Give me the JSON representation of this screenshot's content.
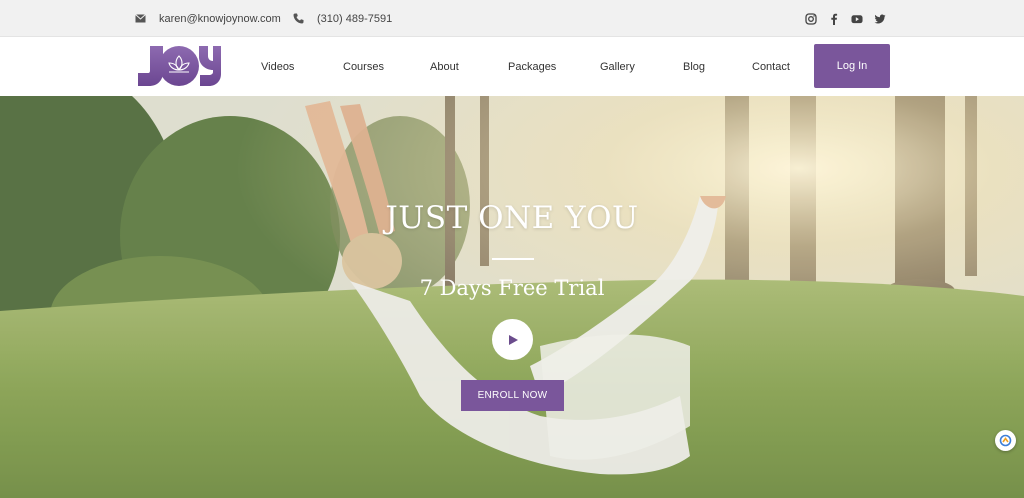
{
  "topbar": {
    "email": "karen@knowjoynow.com",
    "phone": "(310) 489-7591",
    "socials": [
      "instagram-icon",
      "facebook-icon",
      "youtube-icon",
      "twitter-icon"
    ]
  },
  "header": {
    "logo_text": "JOY",
    "nav": [
      {
        "label": "Videos"
      },
      {
        "label": "Courses"
      },
      {
        "label": "About"
      },
      {
        "label": "Packages"
      },
      {
        "label": "Gallery"
      },
      {
        "label": "Blog"
      },
      {
        "label": "Contact"
      }
    ],
    "login_label": "Log In"
  },
  "hero": {
    "title": "JUST ONE YOU",
    "subtitle": "7 Days Free Trial",
    "enroll_label": "ENROLL NOW"
  },
  "colors": {
    "brand_purple": "#7a569b",
    "topbar_bg": "#f1f1f1"
  }
}
